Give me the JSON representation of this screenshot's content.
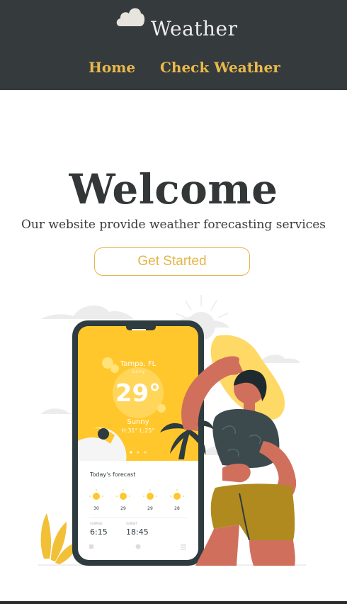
{
  "header": {
    "brand": {
      "title": "Weather",
      "icon": "cloud-icon"
    },
    "nav": [
      {
        "label": "Home"
      },
      {
        "label": "Check Weather"
      }
    ]
  },
  "hero": {
    "title": "Welcome",
    "subtitle": "Our website provide weather forecasting services",
    "cta_label": "Get Started"
  },
  "illustration": {
    "phone": {
      "city": "Tampa, FL",
      "condition_top": "Sunny",
      "temperature": "29°",
      "condition": "Sunny",
      "hi_lo": "H:31° L:25°",
      "forecast_title": "Today's forecast",
      "forecast": [
        {
          "value": "30"
        },
        {
          "value": "29"
        },
        {
          "value": "29"
        },
        {
          "value": "28"
        }
      ],
      "sunrise_label": "SUNRISE",
      "sunrise": "6:15",
      "sunset_label": "SUNSET",
      "sunset": "18:45"
    }
  },
  "colors": {
    "header_bg": "#353a3d",
    "accent": "#e9b94a",
    "phone_yellow": "#ffc72c",
    "skin": "#d0705c",
    "shorts": "#b08a1e",
    "shirt": "#3c4a4e"
  }
}
